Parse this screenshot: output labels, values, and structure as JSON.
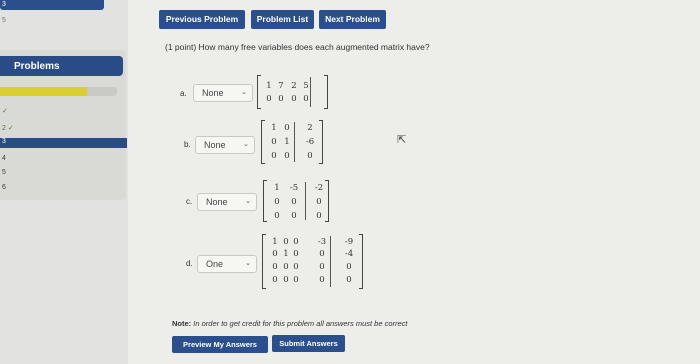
{
  "sidebar": {
    "top_small_1": "3",
    "top_small_2": "5",
    "header": "Problems",
    "progress_fraction": 0.74,
    "items": [
      {
        "label": "✓"
      },
      {
        "label": "2 ✓"
      },
      {
        "label": "3"
      },
      {
        "label": "4"
      },
      {
        "label": "5"
      },
      {
        "label": "6"
      }
    ]
  },
  "nav": {
    "prev_label": "Previous Problem",
    "list_label": "Problem List",
    "next_label": "Next Problem"
  },
  "problem": {
    "text": "(1 point) How many free variables does each augmented matrix have?",
    "parts": [
      {
        "letter": "a.",
        "answer": "None",
        "rows": [
          [
            "1",
            "7",
            "2",
            "5"
          ],
          [
            "0",
            "0",
            "0",
            "0"
          ]
        ]
      },
      {
        "letter": "b.",
        "answer": "None",
        "rows": [
          [
            "1",
            "0",
            "2"
          ],
          [
            "0",
            "1",
            "-6"
          ],
          [
            "0",
            "0",
            "0"
          ]
        ]
      },
      {
        "letter": "c.",
        "answer": "None",
        "rows": [
          [
            "1",
            "-5",
            "-2"
          ],
          [
            "0",
            "0",
            "0"
          ],
          [
            "0",
            "0",
            "0"
          ]
        ]
      },
      {
        "letter": "d.",
        "answer": "One",
        "rows": [
          [
            "1",
            "0",
            "0",
            "-3",
            "-9"
          ],
          [
            "0",
            "1",
            "0",
            "0",
            "-4"
          ],
          [
            "0",
            "0",
            "0",
            "0",
            "0"
          ],
          [
            "0",
            "0",
            "0",
            "0",
            "0"
          ]
        ]
      }
    ],
    "chevron": "⌄"
  },
  "note": {
    "label": "Note:",
    "text": "In order to get credit for this problem all answers must be correct"
  },
  "footer": {
    "preview_label": "Preview My Answers",
    "submit_label": "Submit Answers"
  }
}
